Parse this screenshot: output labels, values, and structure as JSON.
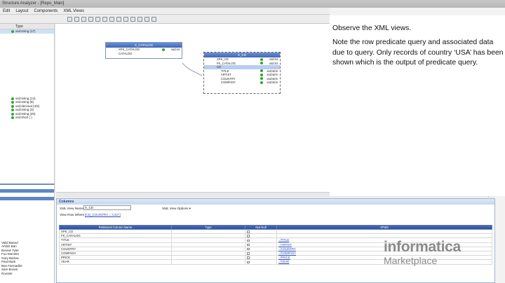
{
  "window": {
    "title": "Structure Analyzer - [Repo_Main]"
  },
  "menu": [
    "Edit",
    "Layout",
    "Components",
    "XML Views"
  ],
  "left_tree": {
    "header": "Type",
    "items": [
      {
        "label": "xsd:string (17)",
        "selected": true
      },
      {
        "label": "xsd:string (14)"
      },
      {
        "label": "xsd:string (8)"
      },
      {
        "label": "xsd:decimal (4/2)"
      },
      {
        "label": "xsd:string (3)"
      },
      {
        "label": "xsd:string (20)"
      },
      {
        "label": "xsd:short ( )"
      }
    ]
  },
  "left_lower": {
    "rows": [
      {
        "label": "",
        "blue": false
      },
      {
        "label": "",
        "blue": true
      },
      {
        "label": "",
        "blue": false
      },
      {
        "label": "",
        "blue": true
      },
      {
        "label": "",
        "blue": false
      },
      {
        "label": "Valid Based",
        "blue": false
      },
      {
        "label": "Artists Ban",
        "blue": false
      },
      {
        "label": "Bonnie Tyler",
        "blue": false
      },
      {
        "label": "Foo Monster",
        "blue": false
      },
      {
        "label": "Gary Barlow",
        "blue": false
      },
      {
        "label": "Paul Mark",
        "blue": false
      },
      {
        "label": "Bee Farmarble",
        "blue": false
      },
      {
        "label": "Sam Brown",
        "blue": false
      },
      {
        "label": "Rooster",
        "blue": false
      }
    ]
  },
  "xml_source": {
    "title": "X_CATALOG",
    "rows": [
      {
        "label": "XPK_CATALOG",
        "type": "xsd:int"
      },
      {
        "label": "CATALOG",
        "type": ""
      }
    ]
  },
  "xml_view": {
    "title": "X_CD",
    "rows": [
      {
        "label": "XPK_CD",
        "type": "xsd:int",
        "indent": 1
      },
      {
        "label": "FK_CATALOG",
        "type": "xsd:int",
        "indent": 1
      },
      {
        "label": "CD",
        "type": "",
        "indent": 1,
        "selected": true
      },
      {
        "label": "TITLE",
        "type": "xsd:strin",
        "indent": 2
      },
      {
        "label": "ARTIST",
        "type": "xsd:strin",
        "indent": 2
      },
      {
        "label": "COUNTRY",
        "type": "xsd:strin",
        "indent": 2
      },
      {
        "label": "COMPANY",
        "type": "xsd:strin",
        "indent": 2
      }
    ]
  },
  "annotation": {
    "line1": "Observe the XML views.",
    "line2": "Note the row predicate query and associated data due to query. Only records of country ‘USA’ has been shown which is the output of predicate query."
  },
  "columns_panel": {
    "title": "Columns",
    "view_name_label": "XML View Name",
    "view_name_value": "X_CD",
    "options_label": "XML View Options ▾",
    "row_where_label": "View Row Where",
    "row_where_value": "[CD_COUNTRY = 'USA']",
    "headers": [
      "Relational Column Name",
      "Type",
      "Not Null",
      "XPath"
    ],
    "rows": [
      {
        "name": "XPK_CD",
        "type": "",
        "xpath": ""
      },
      {
        "name": "FK_CATALOG",
        "type": "",
        "xpath": ""
      },
      {
        "name": "TITLE",
        "type": "",
        "xpath": "../TITLE"
      },
      {
        "name": "ARTIST",
        "type": "",
        "xpath": "../ARTIST"
      },
      {
        "name": "COUNTRY",
        "type": "",
        "xpath": "../COUNTRY"
      },
      {
        "name": "COMPANY",
        "type": "",
        "xpath": "../COMPANY"
      },
      {
        "name": "PRICE",
        "type": "",
        "xpath": "../PRICE"
      },
      {
        "name": "YEAR",
        "type": "",
        "xpath": "../YEAR"
      }
    ]
  },
  "watermark": {
    "brand": "informatica",
    "sub": "Marketplace"
  }
}
